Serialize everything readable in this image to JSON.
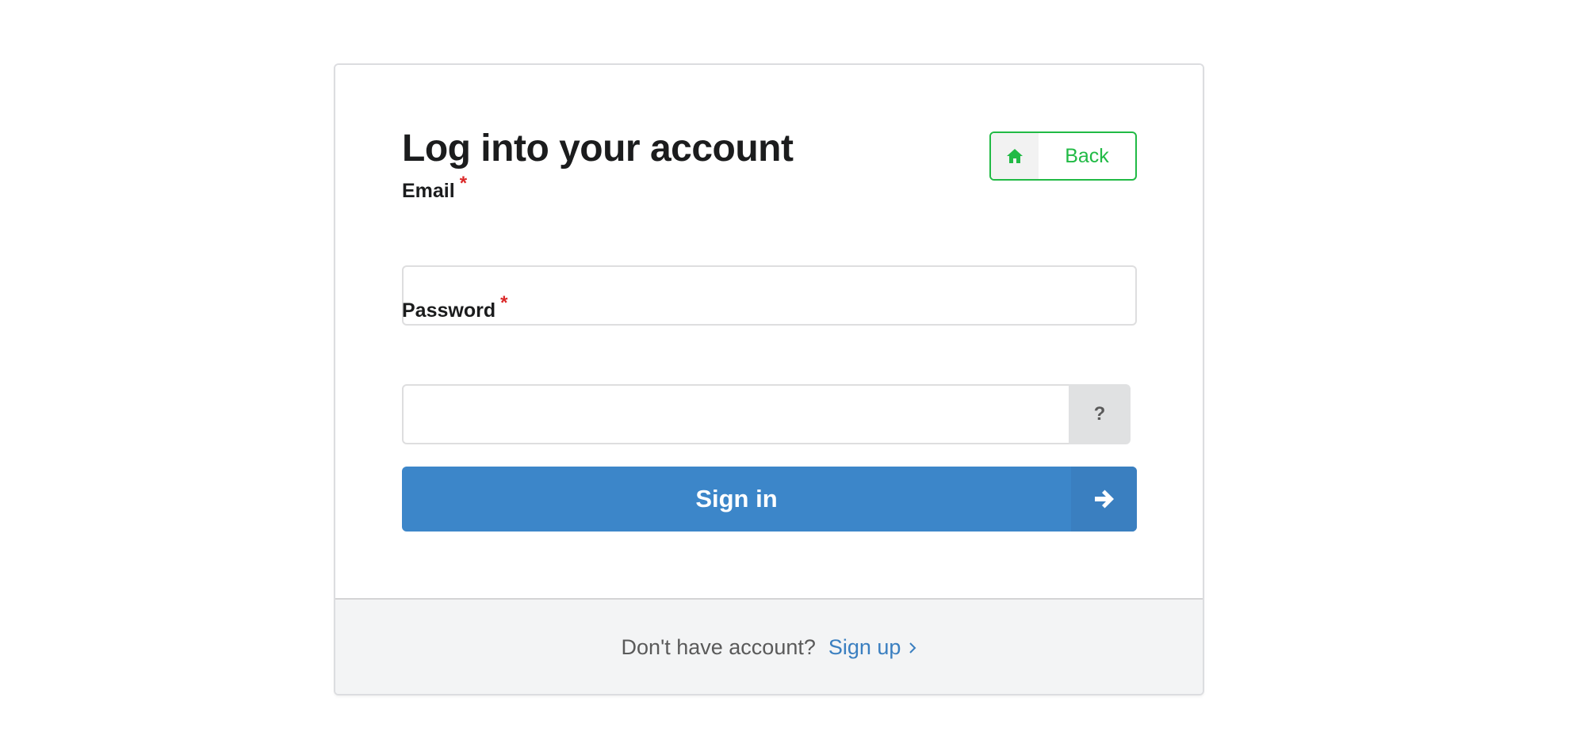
{
  "login": {
    "title": "Log into your account",
    "back_label": "Back",
    "email": {
      "label": "Email",
      "required_mark": "*",
      "value": "",
      "placeholder": ""
    },
    "password": {
      "label": "Password",
      "required_mark": "*",
      "value": "",
      "placeholder": "",
      "help_label": "?"
    },
    "signin_label": "Sign in"
  },
  "footer": {
    "prompt": "Don't have account?",
    "signup_label": "Sign up"
  },
  "icons": {
    "back": "home-icon",
    "signin": "arrow-right-icon",
    "signup": "chevron-right-icon"
  },
  "colors": {
    "primary": "#3c86c9",
    "success": "#21ba45",
    "required": "#db2828",
    "link": "#3a7fc0",
    "footer_bg": "#f3f4f5"
  }
}
